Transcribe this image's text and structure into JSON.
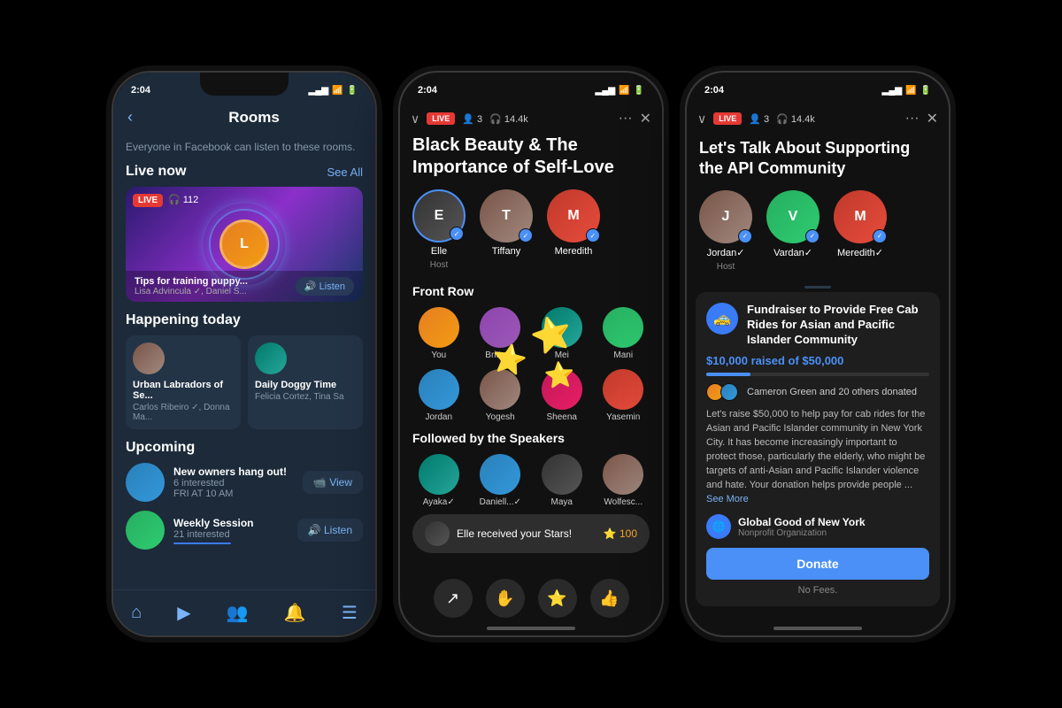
{
  "background": "#000000",
  "phones": {
    "phone1": {
      "status_time": "2:04",
      "title": "Rooms",
      "subtitle": "Everyone in Facebook can listen to these rooms.",
      "live_now": "Live now",
      "see_all": "See All",
      "live_badge": "LIVE",
      "headphone_count": "🎧 112",
      "card_title": "Tips for training puppy...",
      "card_sub": "Lisa Advincula ✓, Daniel S...",
      "listen_label": "🔊 Listen",
      "happening_today": "Happening today",
      "happening1_title": "Urban Labradors of Se...",
      "happening1_sub": "Carlos Ribeiro ✓, Donna Ma...",
      "happening2_title": "Daily Doggy Time",
      "happening2_sub": "Felicia Cortez, Tina Sa",
      "upcoming": "Upcoming",
      "upcoming1_title": "New owners hang out!",
      "upcoming1_meta": "6 interested",
      "upcoming1_date": "FRI AT 10 AM",
      "view_label": "📹 View",
      "upcoming2_title": "Weekly Session",
      "upcoming2_meta": "21 interested",
      "listen_label2": "🔊 Listen"
    },
    "phone2": {
      "status_time": "2:04",
      "live_badge": "LIVE",
      "listeners": "👤 3",
      "headphones": "🎧 14.4k",
      "title": "Black Beauty & The Importance of Self-Love",
      "speakers": [
        {
          "name": "Elle",
          "role": "Host",
          "verified": true
        },
        {
          "name": "Tiffany",
          "role": "",
          "verified": true
        },
        {
          "name": "Meredith",
          "role": "",
          "verified": true
        }
      ],
      "front_row": "Front Row",
      "audience": [
        {
          "name": "You"
        },
        {
          "name": "Brittany"
        },
        {
          "name": "Mei"
        },
        {
          "name": "Mani"
        },
        {
          "name": "Jordan"
        },
        {
          "name": "Yogesh"
        },
        {
          "name": "Sheena"
        },
        {
          "name": "Yasemin"
        }
      ],
      "followed_label": "Followed by the Speakers",
      "followed_people": [
        {
          "name": "Ayaka"
        },
        {
          "name": "Daniell..."
        },
        {
          "name": "Maya"
        },
        {
          "name": "Wolfesc..."
        }
      ],
      "notification": "Elle received your Stars!",
      "stars_count": "⭐ 100"
    },
    "phone3": {
      "status_time": "2:04",
      "live_badge": "LIVE",
      "listeners": "👤 3",
      "headphones": "🎧 14.4k",
      "title": "Let's Talk About Supporting the API Community",
      "speakers": [
        {
          "name": "Jordan",
          "role": "Host",
          "verified": true
        },
        {
          "name": "Vardan",
          "role": "",
          "verified": true
        },
        {
          "name": "Meredith",
          "role": "",
          "verified": true
        }
      ],
      "fundraiser_title": "Fundraiser to Provide Free Cab Rides for Asian and Pacific Islander Community",
      "fundraiser_amount": "$10,000 raised of $50,000",
      "progress_percent": 20,
      "donors_text": "Cameron Green and 20 others donated",
      "fundraiser_desc": "Let's raise $50,000 to help pay for cab rides for the Asian and Pacific Islander community in New York City. It has become increasingly important to protect those, particularly the elderly, who might be targets of anti-Asian and Pacific Islander violence and hate. Your donation helps provide people ...",
      "see_more": "See More",
      "org_name": "Global Good of New York",
      "org_type": "Nonprofit Organization",
      "donate_label": "Donate",
      "no_fees": "No Fees."
    }
  }
}
